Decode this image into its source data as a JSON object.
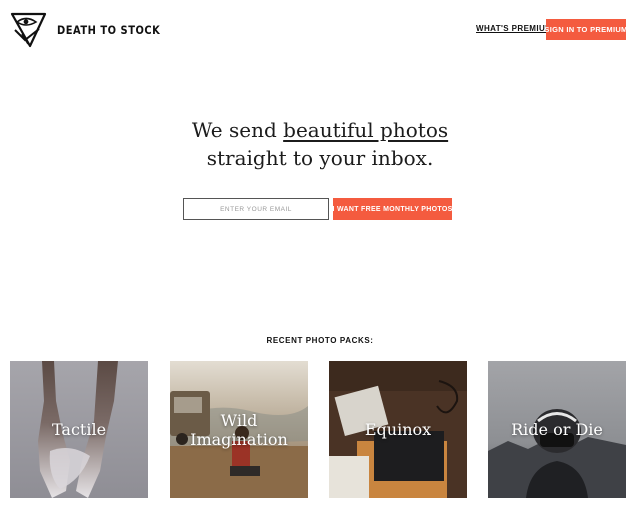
{
  "header": {
    "brand": "DEATH TO STOCK",
    "logo_icon": "eye-triangle-logo-icon",
    "premium_link": "WHAT'S PREMIUM?",
    "signin_label": "SIGN IN TO PREMIUM"
  },
  "hero": {
    "line1_prefix": "We send ",
    "line1_highlight": "beautiful photos",
    "line2": "straight to your inbox."
  },
  "signup": {
    "email_placeholder": "ENTER YOUR EMAIL",
    "email_value": "",
    "cta_label": "I WANT FREE MONTHLY PHOTOS"
  },
  "recent": {
    "title": "RECENT PHOTO PACKS:",
    "packs": [
      {
        "title": "Tactile"
      },
      {
        "title": "Wild Imagination"
      },
      {
        "title": "Equinox"
      },
      {
        "title": "Ride or Die"
      }
    ]
  },
  "colors": {
    "accent": "#f45b3f",
    "text": "#111111",
    "background": "#ffffff"
  }
}
